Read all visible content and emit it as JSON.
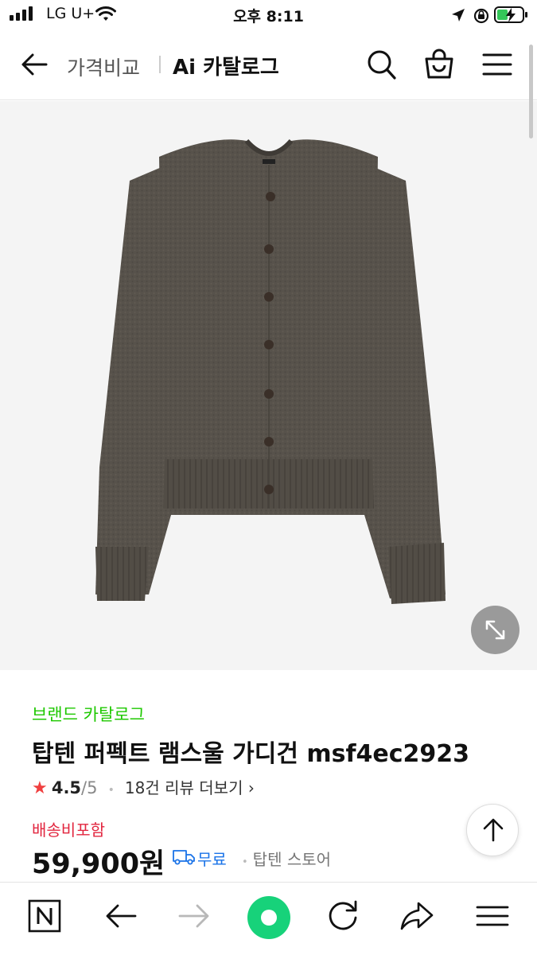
{
  "status_bar": {
    "carrier": "LG U+",
    "time": "오후 8:11"
  },
  "header": {
    "breadcrumb_primary": "가격비교",
    "breadcrumb_current": "Ai 카탈로그",
    "icons": [
      "back-arrow-icon",
      "search-icon",
      "shopping-bag-icon",
      "menu-icon"
    ]
  },
  "product": {
    "image_subject": "charcoal brown lambswool cardigan",
    "brand_label": "브랜드 카탈로그",
    "title": "탑텐 퍼펙트 램스울 가디건 msf4ec2923",
    "rating": "4.5",
    "rating_total": "/5",
    "review_link": "18건 리뷰 더보기",
    "shipping_note": "배송비포함",
    "price": "59,900원",
    "delivery_badge": "무료",
    "store": "탑텐 스토어"
  },
  "colors": {
    "brand_green": "#1ec800",
    "shipping_red": "#e2263f",
    "delivery_blue": "#1a73e8",
    "naver_green": "#17d27a"
  },
  "toolbar": {
    "icons": [
      "naver-home-icon",
      "back-icon",
      "forward-icon",
      "green-dot-icon",
      "reload-icon",
      "share-icon",
      "menu-icon"
    ]
  }
}
